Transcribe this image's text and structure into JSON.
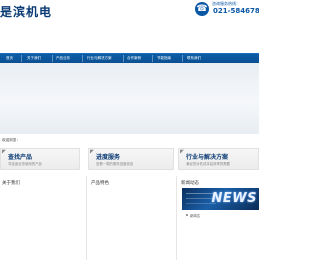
{
  "header": {
    "brand_title": "是滨机电",
    "hotline_label": "咨询服务热线：",
    "hotline_number": "021-58467884"
  },
  "nav": {
    "items": [
      {
        "label": "首页"
      },
      {
        "label": "关于我们"
      },
      {
        "label": "产品业务"
      },
      {
        "label": "行业与解决方案"
      },
      {
        "label": "合作案例"
      },
      {
        "label": "节能指南"
      },
      {
        "label": "联系我们"
      }
    ]
  },
  "main": {
    "section_label": "欢迎浏览：",
    "cards": [
      {
        "title": "查找产品",
        "subtitle": "寻找适合您使用的产品",
        "icon": "arrow-icon"
      },
      {
        "title": "进度服务",
        "subtitle": "查看一周的服务进度信息",
        "icon": "arrow-icon"
      },
      {
        "title": "行业与解决方案",
        "subtitle": "满足您对低成本高效率的需要",
        "icon": "arrow-icon"
      }
    ],
    "columns": [
      {
        "title": "关于我们"
      },
      {
        "title": "产品特色"
      },
      {
        "title": "新闻动态"
      }
    ],
    "news": {
      "image_text": "NEWS",
      "link": "新闻名"
    }
  },
  "colors": {
    "nav_bg": "#0a4f91",
    "brand": "#0b3b75",
    "accent": "#0a57a6"
  }
}
